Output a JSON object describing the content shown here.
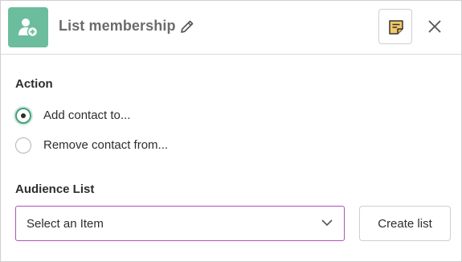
{
  "header": {
    "title": "List membership",
    "app_icon": "add-user-icon",
    "edit_icon": "pencil-icon",
    "notes_icon": "note-icon",
    "close_icon": "close-icon",
    "accent_color": "#6cbd9d"
  },
  "action": {
    "label": "Action",
    "options": [
      {
        "label": "Add contact to...",
        "checked": true
      },
      {
        "label": "Remove contact from...",
        "checked": false
      }
    ]
  },
  "audience_list": {
    "label": "Audience List",
    "select_value": "Select an Item",
    "create_label": "Create list",
    "select_border_color": "#b24fc0"
  }
}
